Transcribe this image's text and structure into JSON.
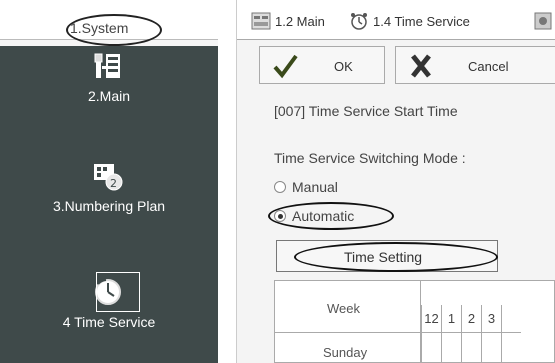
{
  "left_panel": {
    "tab_label": "1.System",
    "nav_items": [
      {
        "label": "2.Main",
        "icon": "tools-icon"
      },
      {
        "label": "3.Numbering Plan",
        "icon": "numbering-plan-icon"
      },
      {
        "label": "4 Time Service",
        "icon": "clock-icon"
      }
    ]
  },
  "right_panel": {
    "tabs": [
      {
        "label": "1.2 Main",
        "icon": "tools-icon"
      },
      {
        "label": "1.4 Time Service",
        "icon": "alarm-clock-icon"
      }
    ],
    "toolbar": {
      "ok_label": "OK",
      "cancel_label": "Cancel"
    },
    "section_title": "[007] Time Service Start Time",
    "mode_label": "Time Service Switching Mode :",
    "modes": [
      {
        "label": "Manual",
        "checked": false
      },
      {
        "label": "Automatic",
        "checked": true
      }
    ],
    "time_setting_label": "Time Setting",
    "schedule": {
      "week_header": "Week",
      "hours": [
        "12",
        "1",
        "2",
        "3"
      ],
      "days": [
        "Sunday"
      ]
    }
  },
  "colors": {
    "nav_background": "#3f4a4a",
    "nav_text": "#ffffff",
    "ok_check": "#3a4a1a",
    "cancel_x": "#333333"
  }
}
